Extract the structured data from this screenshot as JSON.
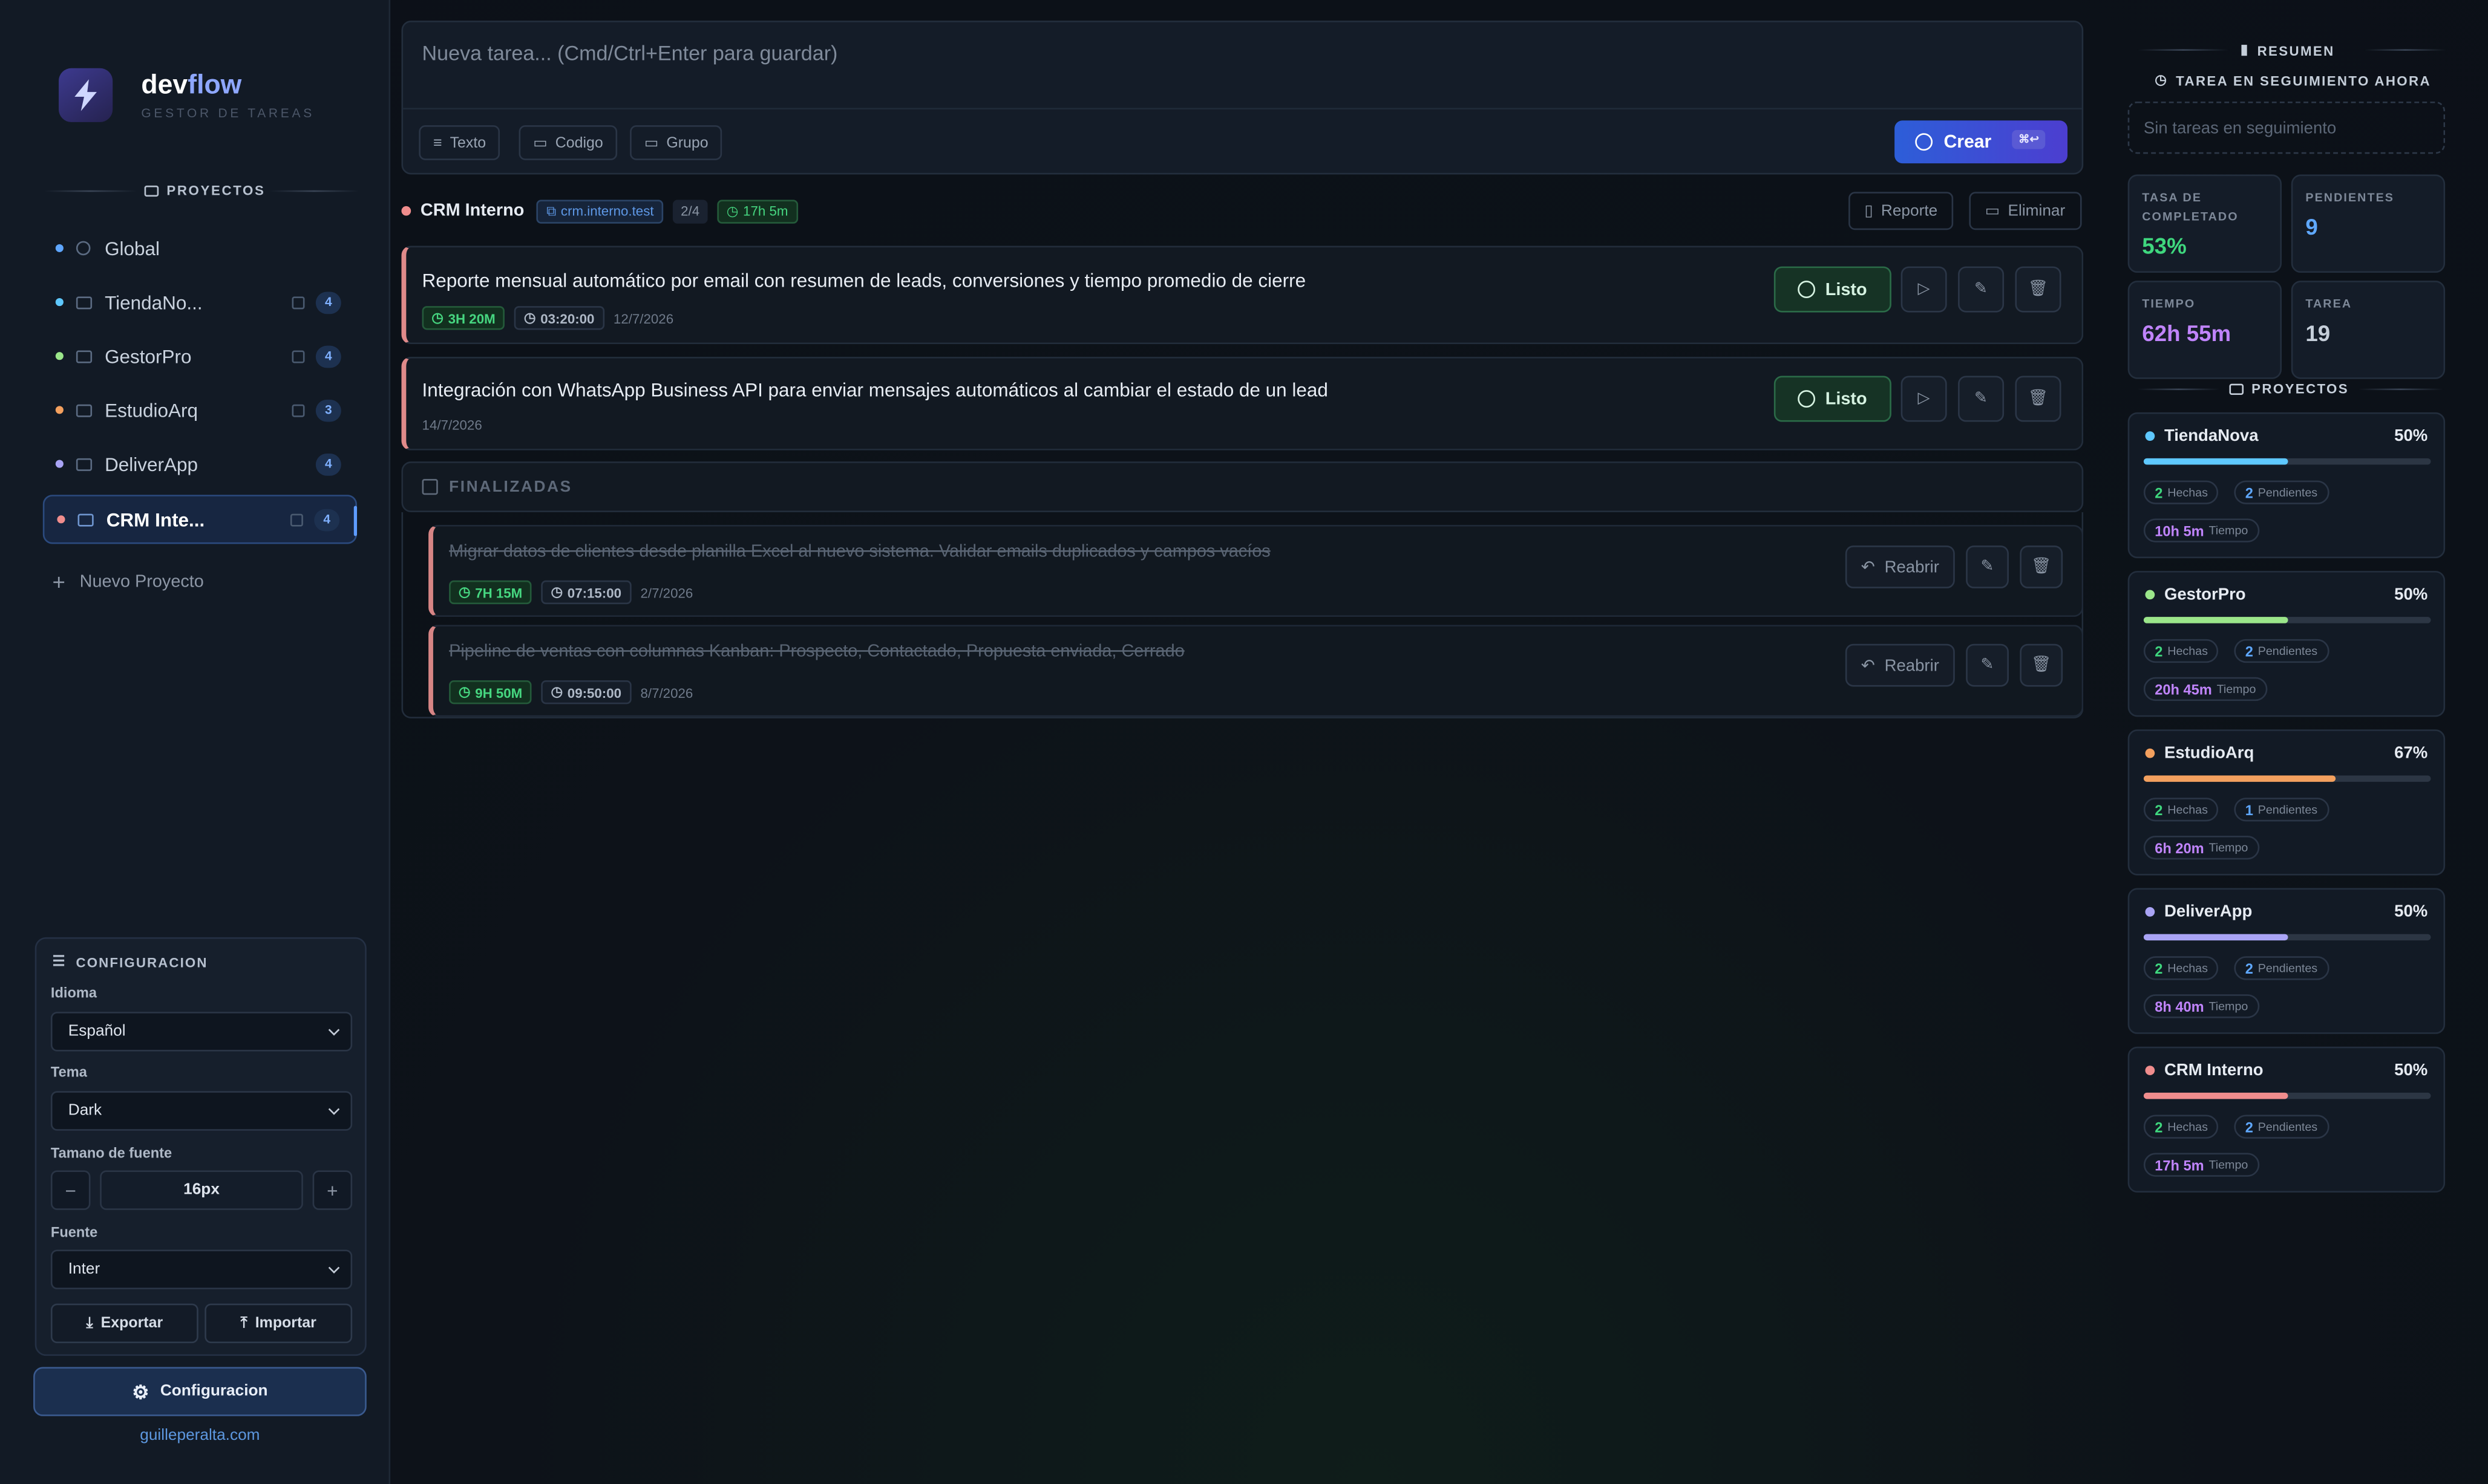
{
  "app": {
    "name_a": "dev",
    "name_b": "flow",
    "subtitle": "GESTOR DE TAREAS"
  },
  "sidebar": {
    "section_title": "PROYECTOS",
    "items": [
      {
        "label": "Global",
        "color": "#5ea6ff"
      },
      {
        "label": "TiendaNo...",
        "count": "4",
        "color": "#5ec8ff"
      },
      {
        "label": "GestorPro",
        "count": "4",
        "color": "#9be68a"
      },
      {
        "label": "EstudioArq",
        "count": "3",
        "color": "#f3a05e"
      },
      {
        "label": "DeliverApp",
        "count": "4",
        "color": "#a9a4f5"
      },
      {
        "label": "CRM Inte...",
        "count": "4",
        "color": "#f08d8d"
      }
    ],
    "new_project": "Nuevo Proyecto"
  },
  "config": {
    "title": "CONFIGURACION",
    "language_label": "Idioma",
    "language_value": "Español",
    "theme_label": "Tema",
    "theme_value": "Dark",
    "fontsize_label": "Tamano de fuente",
    "fontsize_value": "16px",
    "font_label": "Fuente",
    "font_value": "Inter",
    "export_label": "Exportar",
    "import_label": "Importar",
    "main_button": "Configuracion",
    "footer_link": "guilleperalta.com"
  },
  "new_task": {
    "placeholder": "Nueva tarea... (Cmd/Ctrl+Enter para guardar)",
    "chips": [
      "Texto",
      "Codigo",
      "Grupo"
    ],
    "create_label": "Crear",
    "create_kbd": "⌘↩"
  },
  "project_header": {
    "name": "CRM Interno",
    "url": "crm.interno.test",
    "progress": "2/4",
    "time": "17h 5m",
    "report_label": "Reporte",
    "delete_label": "Eliminar"
  },
  "tasks": [
    {
      "title": "Reporte mensual automático por email con resumen de leads, conversiones y tiempo promedio de cierre",
      "time_tag": "3H 20M",
      "timer": "03:20:00",
      "date": "12/7/2026",
      "done_label": "Listo"
    },
    {
      "title": "Integración con WhatsApp Business API para enviar mensajes automáticos al cambiar el estado de un lead",
      "date": "14/7/2026",
      "done_label": "Listo"
    }
  ],
  "finished": {
    "title": "FINALIZADAS",
    "items": [
      {
        "title": "Migrar datos de clientes desde planilla Excel al nuevo sistema. Validar emails duplicados y campos vacíos",
        "time_tag": "7H 15M",
        "timer": "07:15:00",
        "date": "2/7/2026",
        "reopen_label": "Reabrir"
      },
      {
        "title": "Pipeline de ventas con columnas Kanban: Prospecto, Contactado, Propuesta enviada, Cerrado",
        "time_tag": "9H 50M",
        "timer": "09:50:00",
        "date": "8/7/2026",
        "reopen_label": "Reabrir"
      }
    ]
  },
  "summary": {
    "title": "RESUMEN",
    "tracking_title": "TAREA EN SEGUIMIENTO AHORA",
    "tracking_empty": "Sin tareas en seguimiento",
    "stats": [
      {
        "label": "TASA DE COMPLETADO",
        "value": "53%",
        "color": "#3fd77e"
      },
      {
        "label": "PENDIENTES",
        "value": "9",
        "color": "#5fa8ff"
      },
      {
        "label": "TIEMPO",
        "value": "62h 55m",
        "color": "#c084fc"
      },
      {
        "label": "TAREA",
        "value": "19",
        "color": "#c5ced9"
      }
    ],
    "projects_title": "PROYECTOS",
    "done_word": "Hechas",
    "pending_word": "Pendientes",
    "time_word": "Tiempo",
    "projects": [
      {
        "name": "TiendaNova",
        "pct": "50%",
        "progress": 0.5,
        "color": "#5ec8ff",
        "done": "2",
        "pending": "2",
        "time": "10h 5m"
      },
      {
        "name": "GestorPro",
        "pct": "50%",
        "progress": 0.5,
        "color": "#9be68a",
        "done": "2",
        "pending": "2",
        "time": "20h 45m"
      },
      {
        "name": "EstudioArq",
        "pct": "67%",
        "progress": 0.67,
        "color": "#f3a05e",
        "done": "2",
        "pending": "1",
        "time": "6h 20m"
      },
      {
        "name": "DeliverApp",
        "pct": "50%",
        "progress": 0.5,
        "color": "#a9a4f5",
        "done": "2",
        "pending": "2",
        "time": "8h 40m"
      },
      {
        "name": "CRM Interno",
        "pct": "50%",
        "progress": 0.5,
        "color": "#f08d8d",
        "done": "2",
        "pending": "2",
        "time": "17h 5m"
      }
    ]
  }
}
